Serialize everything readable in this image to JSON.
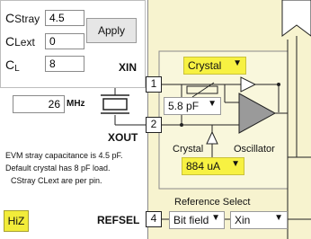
{
  "inputs": {
    "cstray": {
      "label_c": "C",
      "label_sub": "Stray",
      "value": "4.5"
    },
    "clext": {
      "label_c": "C",
      "label_sub": "Lext",
      "value": "0"
    },
    "cl": {
      "label_c": "C",
      "label_sub": "L",
      "value": "8"
    }
  },
  "apply_label": "Apply",
  "frequency": {
    "value": "26",
    "unit": "MHz"
  },
  "pins": {
    "xin": {
      "num": "1",
      "label": "XIN"
    },
    "xout": {
      "num": "2",
      "label": "XOUT"
    },
    "refsel": {
      "num": "4",
      "label": "REFSEL"
    }
  },
  "mode_select": {
    "value": "Crystal"
  },
  "cap_select": {
    "value": "5.8 pF"
  },
  "current_select": {
    "value": "884 uA"
  },
  "crystal_label": "Crystal",
  "oscillator_label": "Oscillator",
  "reference_select_label": "Reference Select",
  "refsel_source": {
    "value": "Bit field"
  },
  "refsel_output": {
    "value": "Xin"
  },
  "notes": [
    "EVM stray capacitance is 4.5 pF.",
    "Default crystal has 8 pF load.",
    "CStray CLext are per pin."
  ],
  "hiz_label": "HiZ",
  "colors": {
    "chip_bg": "#f7f3cf",
    "highlight": "#f7f142",
    "hiz_bg": "#f2ec3a"
  }
}
